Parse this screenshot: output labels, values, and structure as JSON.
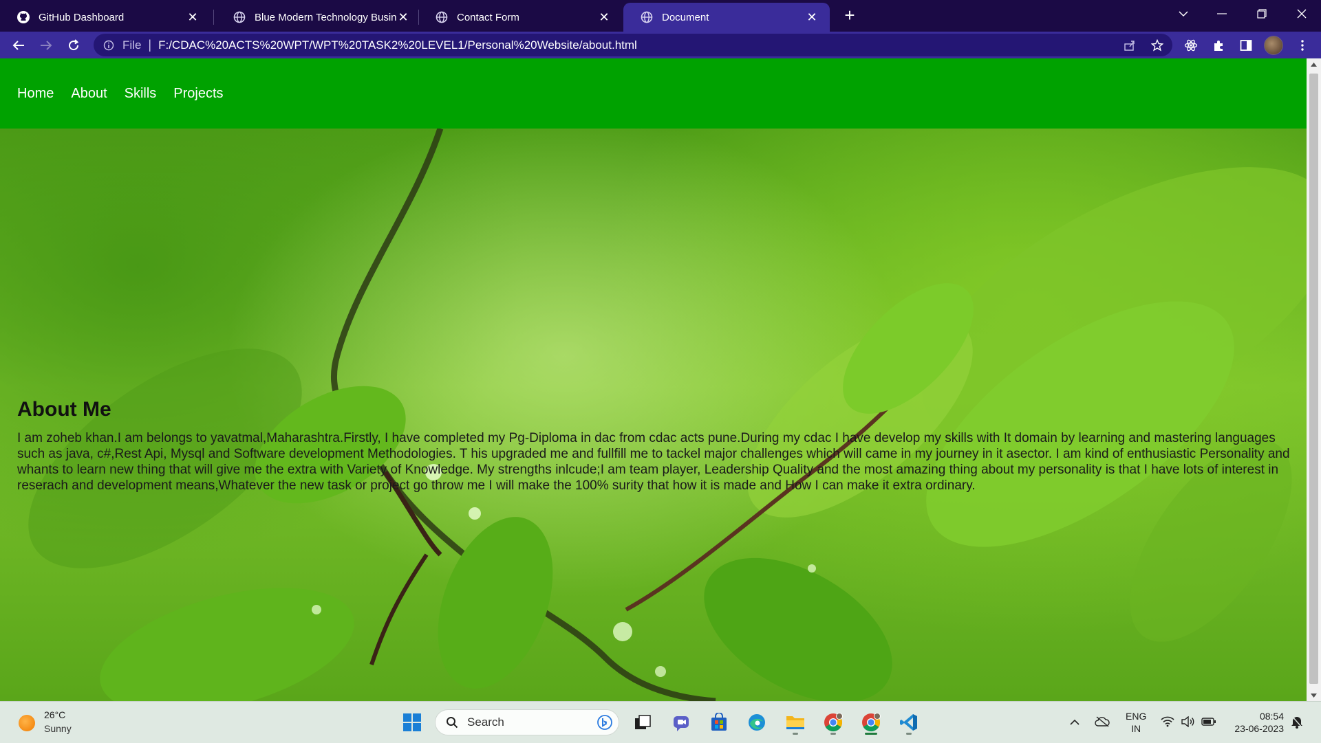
{
  "browser": {
    "tabs": [
      {
        "title": "GitHub Dashboard",
        "icon": "github-icon",
        "active": false
      },
      {
        "title": "Blue Modern Technology Busines",
        "icon": "globe-icon",
        "active": false
      },
      {
        "title": "Contact Form",
        "icon": "globe-icon",
        "active": false
      },
      {
        "title": "Document",
        "icon": "globe-icon",
        "active": true
      }
    ],
    "address": {
      "scheme_label": "File",
      "url": "F:/CDAC%20ACTS%20WPT/WPT%20TASK2%20LEVEL1/Personal%20Website/about.html"
    },
    "colors": {
      "tab_strip": "#1b0a45",
      "toolbar": "#3a2c9a",
      "omnibox": "#241674"
    }
  },
  "site": {
    "nav": [
      "Home",
      "About",
      "Skills",
      "Projects"
    ],
    "nav_color": "#00a200",
    "about_title": "About Me",
    "about_text": "I am zoheb khan.I am belongs to yavatmal,Maharashtra.Firstly, I have completed my Pg-Diploma in dac from cdac acts pune.During my cdac I have develop my skills with It domain by learning and mastering languages such as java, c#,Rest Api, Mysql and Software development Methodologies. T his upgraded me and fullfill me to tackel major challenges which will came in my journey in it asector. I am kind of enthusiastic Personality and whants to learn new thing that will give me the extra with Variety of Knowledge. My strengths inlcude;I am team player, Leadership Quality and the most amazing thing about my personality is that I have lots of interest in reserach and development means,Whatever the new task or project go throw me I will make the 100% surity that how it is made and How I can make it extra ordinary."
  },
  "taskbar": {
    "weather": {
      "temp": "26°C",
      "desc": "Sunny"
    },
    "search_label": "Search",
    "lang": {
      "line1": "ENG",
      "line2": "IN"
    },
    "clock": {
      "time": "08:54",
      "date": "23-06-2023"
    }
  }
}
